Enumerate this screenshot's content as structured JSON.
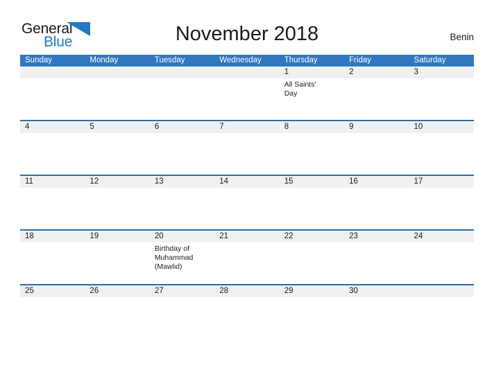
{
  "brand": {
    "name_part_1": "General",
    "name_part_2": "Blue",
    "flag_icon": "blue-triangle-flag-icon",
    "accent_color": "#1f7bc1"
  },
  "header": {
    "title": "November 2018",
    "region": "Benin"
  },
  "theme": {
    "header_blue": "#3077be",
    "row_divider_blue": "#2e6da4",
    "daynum_band_gray": "#f0f0f0",
    "text_dark": "#1a1a1a"
  },
  "calendar": {
    "month": "November",
    "year": "2018",
    "weekday_headers": [
      "Sunday",
      "Monday",
      "Tuesday",
      "Wednesday",
      "Thursday",
      "Friday",
      "Saturday"
    ],
    "weeks": [
      {
        "days": [
          {
            "num": "",
            "event": ""
          },
          {
            "num": "",
            "event": ""
          },
          {
            "num": "",
            "event": ""
          },
          {
            "num": "",
            "event": ""
          },
          {
            "num": "1",
            "event": "All Saints' Day"
          },
          {
            "num": "2",
            "event": ""
          },
          {
            "num": "3",
            "event": ""
          }
        ]
      },
      {
        "days": [
          {
            "num": "4",
            "event": ""
          },
          {
            "num": "5",
            "event": ""
          },
          {
            "num": "6",
            "event": ""
          },
          {
            "num": "7",
            "event": ""
          },
          {
            "num": "8",
            "event": ""
          },
          {
            "num": "9",
            "event": ""
          },
          {
            "num": "10",
            "event": ""
          }
        ]
      },
      {
        "days": [
          {
            "num": "11",
            "event": ""
          },
          {
            "num": "12",
            "event": ""
          },
          {
            "num": "13",
            "event": ""
          },
          {
            "num": "14",
            "event": ""
          },
          {
            "num": "15",
            "event": ""
          },
          {
            "num": "16",
            "event": ""
          },
          {
            "num": "17",
            "event": ""
          }
        ]
      },
      {
        "days": [
          {
            "num": "18",
            "event": ""
          },
          {
            "num": "19",
            "event": ""
          },
          {
            "num": "20",
            "event": "Birthday of Muhammad (Mawlid)"
          },
          {
            "num": "21",
            "event": ""
          },
          {
            "num": "22",
            "event": ""
          },
          {
            "num": "23",
            "event": ""
          },
          {
            "num": "24",
            "event": ""
          }
        ]
      },
      {
        "days": [
          {
            "num": "25",
            "event": ""
          },
          {
            "num": "26",
            "event": ""
          },
          {
            "num": "27",
            "event": ""
          },
          {
            "num": "28",
            "event": ""
          },
          {
            "num": "29",
            "event": ""
          },
          {
            "num": "30",
            "event": ""
          },
          {
            "num": "",
            "event": ""
          }
        ]
      }
    ]
  }
}
